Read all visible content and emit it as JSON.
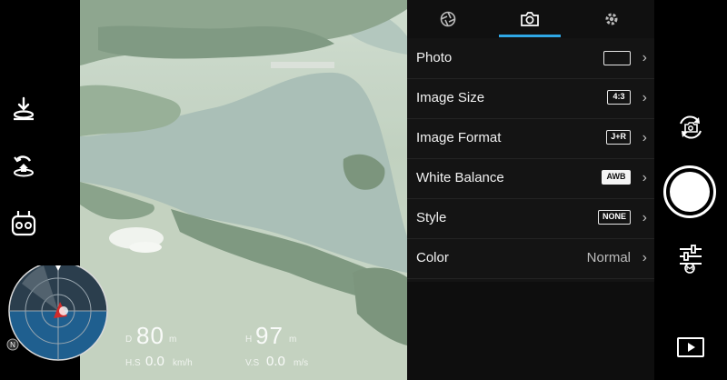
{
  "telemetry": {
    "d_label": "D",
    "d_value": "80",
    "d_unit": "m",
    "h_label": "H",
    "h_value": "97",
    "h_unit": "m",
    "hs_label": "H.S",
    "hs_value": "0.0",
    "hs_unit": "km/h",
    "vs_label": "V.S",
    "vs_value": "0.0",
    "vs_unit": "m/s"
  },
  "radar": {
    "north_label": "N"
  },
  "settings": {
    "tabs": [
      {
        "icon": "aperture-icon",
        "active": false
      },
      {
        "icon": "camera-icon",
        "active": true
      },
      {
        "icon": "gear-icon",
        "active": false
      }
    ],
    "rows": [
      {
        "label": "Photo",
        "badge": ""
      },
      {
        "label": "Image Size",
        "badge": "4:3"
      },
      {
        "label": "Image Format",
        "badge": "J+R"
      },
      {
        "label": "White Balance",
        "badge": "AWB"
      },
      {
        "label": "Style",
        "badge": "NONE"
      },
      {
        "label": "Color",
        "value": "Normal"
      }
    ],
    "chevron": "›"
  },
  "colors": {
    "accent": "#2fa8e6",
    "panel_bg": "#141414"
  }
}
